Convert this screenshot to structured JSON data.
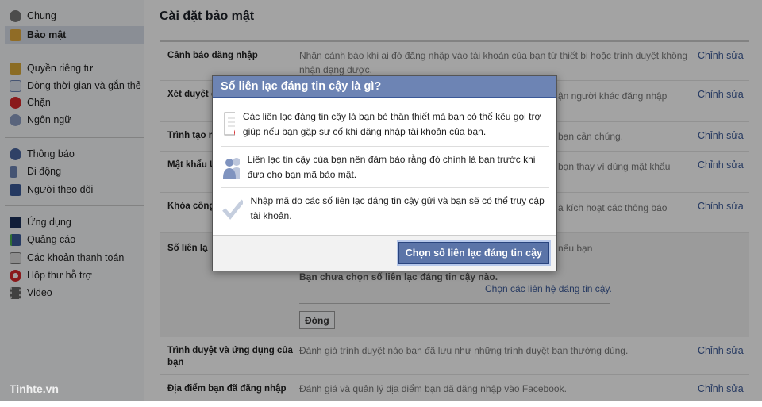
{
  "sidebar": {
    "items": [
      {
        "label": "Chung",
        "icon": "gears-icon"
      },
      {
        "label": "Bảo mật",
        "icon": "badge-icon",
        "selected": true
      },
      {
        "label": "Quyền riêng tư",
        "icon": "lock-icon"
      },
      {
        "label": "Dòng thời gian và gắn thẻ",
        "icon": "timeline-icon"
      },
      {
        "label": "Chặn",
        "icon": "block-icon"
      },
      {
        "label": "Ngôn ngữ",
        "icon": "globe-grid-icon"
      },
      {
        "label": "Thông báo",
        "icon": "globe-icon"
      },
      {
        "label": "Di động",
        "icon": "phone-icon"
      },
      {
        "label": "Người theo dõi",
        "icon": "rss-icon"
      },
      {
        "label": "Ứng dụng",
        "icon": "apps-icon"
      },
      {
        "label": "Quảng cáo",
        "icon": "ads-icon"
      },
      {
        "label": "Các khoản thanh toán",
        "icon": "card-icon"
      },
      {
        "label": "Hộp thư hỗ trợ",
        "icon": "lifebuoy-icon"
      },
      {
        "label": "Video",
        "icon": "film-icon"
      }
    ]
  },
  "main": {
    "title": "Cài đặt bảo mật",
    "edit_label": "Chỉnh sửa",
    "rows": [
      {
        "label": "Cảnh báo đăng nhập",
        "desc": "Nhận cảnh báo khi ai đó đăng nhập vào tài khoản của bạn từ thiết bị hoặc trình duyệt không nhận dạng được."
      },
      {
        "label": "Xét duyệt đ",
        "desc": "ận người khác đăng nhập"
      },
      {
        "label": "Trình tạo m",
        "desc": "bạn cần chúng."
      },
      {
        "label": "Mật khẩu Ứ",
        "desc": "bạn thay vì dùng mật khẩu"
      },
      {
        "label": "Khóa công",
        "desc": "à kích hoạt các thông báo"
      },
      {
        "label": "Trình duyệt và ứng dụng của bạn",
        "desc": "Đánh giá trình duyệt nào bạn đã lưu như những trình duyệt bạn thường dùng."
      },
      {
        "label": "Địa điểm bạn đã đăng nhập",
        "desc": "Đánh giá và quản lý địa điểm bạn đã đăng nhập vào Facebook."
      }
    ],
    "expanded": {
      "label": "Số liên lạ",
      "desc_fragment": "nếu bạn",
      "status": "Bạn chưa chọn số liên lạc đáng tin cậy nào.",
      "choose_link": "Chọn các liên hệ đáng tin cậy.",
      "close_button": "Đóng"
    }
  },
  "dialog": {
    "title": "Số liên lạc đáng tin cậy là gì?",
    "items": [
      {
        "icon": "contact-list-icon",
        "text": "Các liên lạc đáng tin cậy là bạn bè thân thiết mà bạn có thể kêu gọi trợ giúp nếu bạn gặp sự cố khi đăng nhập tài khoản của bạn."
      },
      {
        "icon": "friends-icon",
        "text": "Liên lạc tin cậy của bạn nên đảm bảo rằng đó chính là bạn trước khi đưa cho bạn mã bảo mật."
      },
      {
        "icon": "checkmark-icon",
        "text": "Nhập mã do các số liên lạc đáng tin cậy gửi và bạn sẽ có thể truy cập tài khoản."
      }
    ],
    "confirm_button": "Chọn số liên lạc đáng tin cậy"
  },
  "watermark": "Tinhte.vn",
  "colors": {
    "brand": "#3b5998",
    "dialog_header": "#6d84b4"
  }
}
